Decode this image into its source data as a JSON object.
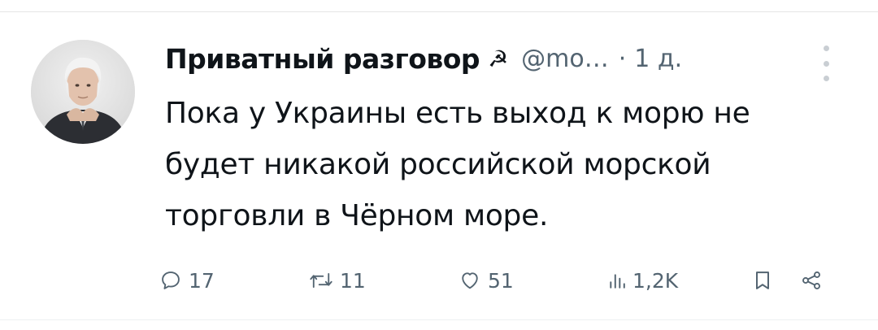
{
  "tweet": {
    "author": {
      "display_name": "Приватный разговор",
      "name_emoji": "☭",
      "handle": "@mo…",
      "avatar_icon": "user-avatar-photo"
    },
    "separator": "·",
    "time": "1 д.",
    "text": "Пока у Украины есть выход к морю не будет никакой российской морской торговли в Чёрном море."
  },
  "actions": {
    "reply_count": "17",
    "retweet_count": "11",
    "like_count": "51",
    "views_count": "1,2K"
  },
  "icons": {
    "reply": "comment-icon",
    "retweet": "retweet-icon",
    "like": "heart-icon",
    "views": "bar-chart-icon",
    "bookmark": "bookmark-icon",
    "share": "share-icon",
    "more": "more-vertical-icon"
  },
  "colors": {
    "text": "#0f1419",
    "secondary": "#536471",
    "divider": "#e6e6e6"
  }
}
